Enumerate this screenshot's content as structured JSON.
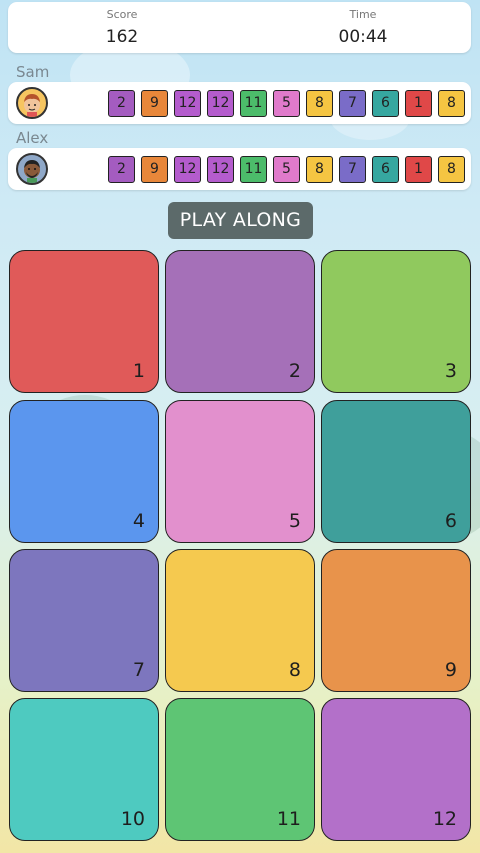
{
  "score": {
    "label": "Score",
    "value": "162"
  },
  "time": {
    "label": "Time",
    "value": "00:44"
  },
  "players": [
    {
      "name": "Sam",
      "avatar_icon": "boy-avatar-icon",
      "sequence": [
        "2",
        "9",
        "12",
        "12",
        "11",
        "5",
        "8",
        "7",
        "6",
        "1",
        "8"
      ]
    },
    {
      "name": "Alex",
      "avatar_icon": "man-avatar-icon",
      "sequence": [
        "2",
        "9",
        "12",
        "12",
        "11",
        "5",
        "8",
        "7",
        "6",
        "1",
        "8"
      ]
    }
  ],
  "play_along_label": "PLAY ALONG",
  "tiles": [
    {
      "number": "1",
      "color": "#e05a59"
    },
    {
      "number": "2",
      "color": "#a570b8"
    },
    {
      "number": "3",
      "color": "#90c95e"
    },
    {
      "number": "4",
      "color": "#5b96ee"
    },
    {
      "number": "5",
      "color": "#e290cd"
    },
    {
      "number": "6",
      "color": "#3f9f9b"
    },
    {
      "number": "7",
      "color": "#7d76be"
    },
    {
      "number": "8",
      "color": "#f5c94f"
    },
    {
      "number": "9",
      "color": "#e8934b"
    },
    {
      "number": "10",
      "color": "#4ecac0"
    },
    {
      "number": "11",
      "color": "#5ec574"
    },
    {
      "number": "12",
      "color": "#b370c9"
    }
  ],
  "chip_colors": {
    "1": "#e04848",
    "2": "#a45cc0",
    "3": "#86c955",
    "4": "#5b8de8",
    "5": "#e07acb",
    "6": "#36a7a0",
    "7": "#7a6cc8",
    "8": "#f5c542",
    "9": "#e8873a",
    "10": "#4ec9c0",
    "11": "#4cbc6a",
    "12": "#b45ccd"
  }
}
